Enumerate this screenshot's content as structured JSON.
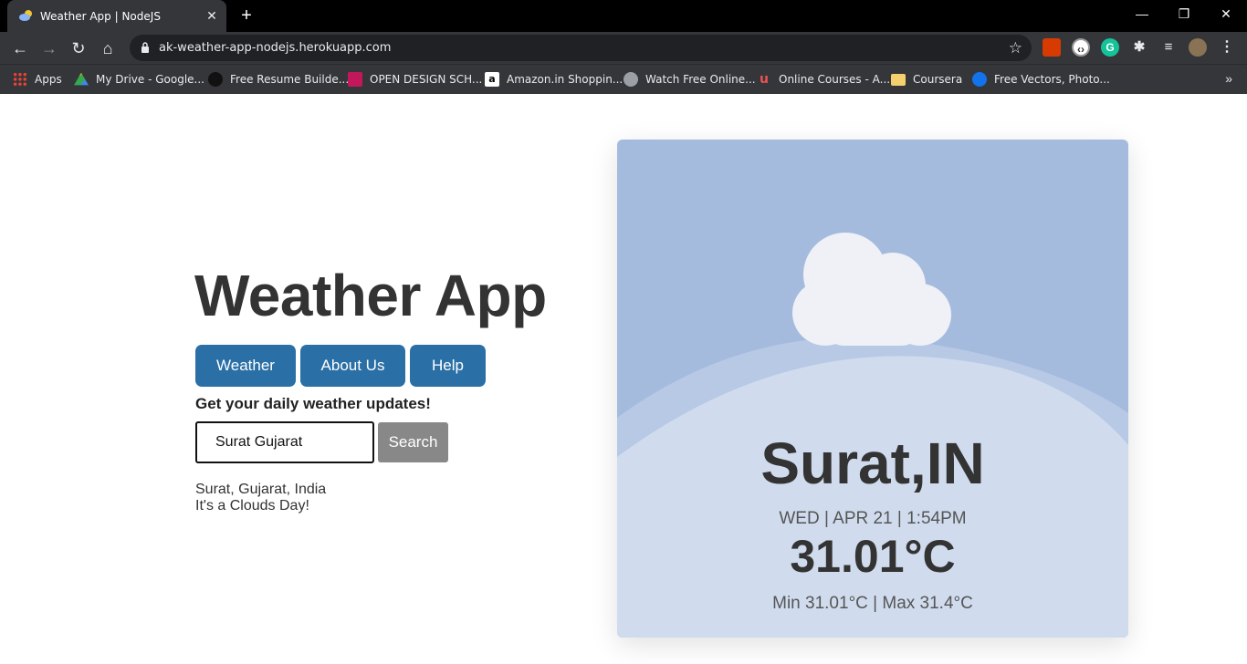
{
  "browser": {
    "tab_title": "Weather App | NodeJS",
    "url": "ak-weather-app-nodejs.herokuapp.com",
    "bookmarks": [
      {
        "label": "Apps",
        "icon": "apps-grid-icon",
        "color": "#ea4335"
      },
      {
        "label": "My Drive - Google...",
        "icon": "google-drive-icon",
        "color": "#34a853"
      },
      {
        "label": "Free Resume Builde...",
        "icon": "resume-builder-icon",
        "color": "#111111"
      },
      {
        "label": "OPEN DESIGN SCH...",
        "icon": "open-design-icon",
        "color": "#c2185b"
      },
      {
        "label": "Amazon.in Shoppin...",
        "icon": "amazon-icon",
        "color": "#ffffff"
      },
      {
        "label": "Watch Free Online...",
        "icon": "globe-icon",
        "color": "#9aa0a6"
      },
      {
        "label": "Online Courses - A...",
        "icon": "udemy-icon",
        "color": "#ec5252"
      },
      {
        "label": "Coursera",
        "icon": "folder-icon",
        "color": "#f4d06f"
      },
      {
        "label": "Free Vectors, Photo...",
        "icon": "freepik-icon",
        "color": "#1273eb"
      }
    ]
  },
  "app": {
    "title": "Weather App",
    "nav": [
      "Weather",
      "About Us",
      "Help"
    ],
    "tagline": "Get your daily weather updates!",
    "search": {
      "value": "Surat Gujarat",
      "button": "Search"
    },
    "result": {
      "location": "Surat, Gujarat, India",
      "condition": "It's a Clouds Day!"
    }
  },
  "card": {
    "city": "Surat,IN",
    "datetime": "WED | APR 21 | 1:54PM",
    "temperature": "31.01°C",
    "minmax": "Min 31.01°C | Max 31.4°C",
    "weather_icon": "cloud-icon"
  },
  "colors": {
    "accent": "#2a6fa5",
    "card_bg": "#a5bbde",
    "card_hill": "#d0dcee"
  }
}
